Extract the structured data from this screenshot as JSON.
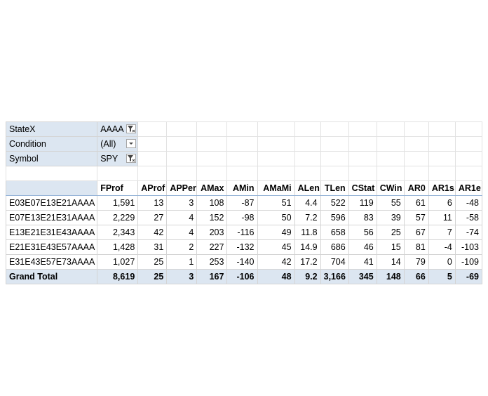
{
  "filters": [
    {
      "label": "StateX",
      "value": "AAAA",
      "icon": "filter-funnel-icon"
    },
    {
      "label": "Condition",
      "value": "(All)",
      "icon": "dropdown-arrow-icon"
    },
    {
      "label": "Symbol",
      "value": "SPY",
      "icon": "filter-funnel-icon"
    }
  ],
  "columns": [
    "FProf",
    "AProf",
    "APPer",
    "AMax",
    "AMin",
    "AMaMi",
    "ALen",
    "TLen",
    "CStat",
    "CWin",
    "AR0",
    "AR1s",
    "AR1e"
  ],
  "rows": [
    {
      "label": "E03E07E13E21AAAA",
      "values": [
        "1,591",
        "13",
        "3",
        "108",
        "-87",
        "51",
        "4.4",
        "522",
        "119",
        "55",
        "61",
        "6",
        "-48"
      ]
    },
    {
      "label": "E07E13E21E31AAAA",
      "values": [
        "2,229",
        "27",
        "4",
        "152",
        "-98",
        "50",
        "7.2",
        "596",
        "83",
        "39",
        "57",
        "11",
        "-58"
      ]
    },
    {
      "label": "E13E21E31E43AAAA",
      "values": [
        "2,343",
        "42",
        "4",
        "203",
        "-116",
        "49",
        "11.8",
        "658",
        "56",
        "25",
        "67",
        "7",
        "-74"
      ]
    },
    {
      "label": "E21E31E43E57AAAA",
      "values": [
        "1,428",
        "31",
        "2",
        "227",
        "-132",
        "45",
        "14.9",
        "686",
        "46",
        "15",
        "81",
        "-4",
        "-103"
      ]
    },
    {
      "label": "E31E43E57E73AAAA",
      "values": [
        "1,027",
        "25",
        "1",
        "253",
        "-140",
        "42",
        "17.2",
        "704",
        "41",
        "14",
        "79",
        "0",
        "-109"
      ]
    }
  ],
  "total": {
    "label": "Grand Total",
    "values": [
      "8,619",
      "25",
      "3",
      "167",
      "-106",
      "48",
      "9.2",
      "3,166",
      "345",
      "148",
      "66",
      "5",
      "-69"
    ]
  }
}
